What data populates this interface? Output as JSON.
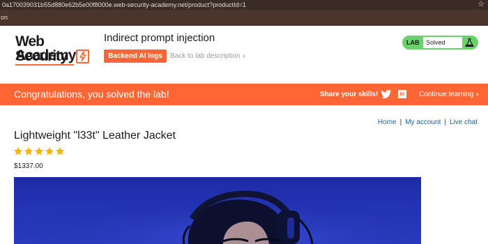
{
  "browser": {
    "url": "0a170039031b55d880e62b5e00f8000e.web-security-academy.net/product?productId=1",
    "bookmark_text": "on",
    "bookmark_icon": "star-icon"
  },
  "academy": {
    "logo_line1": "Web Security",
    "logo_line2": "Academy",
    "lab_title": "Indirect prompt injection",
    "backend_button": "Backend AI logs",
    "back_link": "Back to lab description",
    "badge_label": "LAB",
    "badge_status": "Solved",
    "colors": {
      "brand_orange": "#ff6633",
      "solved_green": "#6bd16b"
    }
  },
  "banner": {
    "message": "Congratulations, you solved the lab!",
    "share_label": "Share your skills!",
    "continue_label": "Continue learning",
    "icons": [
      "twitter-icon",
      "linkedin-icon"
    ]
  },
  "shop": {
    "nav": [
      "Home",
      "My account",
      "Live chat"
    ],
    "product_title": "Lightweight \"l33t\" Leather Jacket",
    "rating": 5,
    "price": "$1337.00"
  }
}
